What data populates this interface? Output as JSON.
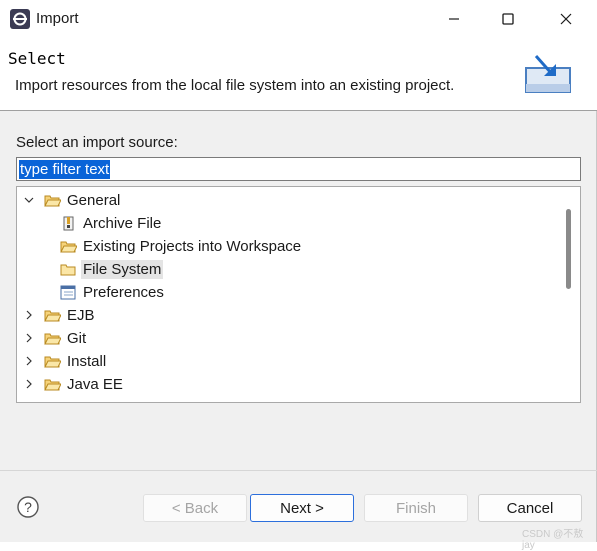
{
  "window": {
    "title": "Import",
    "icon": "eclipse-icon",
    "controls": {
      "minimize": "minimize-icon",
      "maximize": "maximize-icon",
      "close": "close-icon"
    }
  },
  "header": {
    "title": "Select",
    "description": "Import resources from the local file system into an existing project.",
    "graphic": "import-wizard-icon"
  },
  "source": {
    "label": "Select an import source:",
    "filter_value": "type filter text"
  },
  "tree": {
    "items": [
      {
        "label": "General",
        "expanded": true,
        "icon": "folder-open-icon"
      },
      {
        "label": "Archive File",
        "icon": "archive-file-icon"
      },
      {
        "label": "Existing Projects into Workspace",
        "icon": "folder-project-icon"
      },
      {
        "label": "File System",
        "icon": "folder-icon",
        "selected": true
      },
      {
        "label": "Preferences",
        "icon": "preferences-icon"
      },
      {
        "label": "EJB",
        "expanded": false,
        "icon": "folder-icon"
      },
      {
        "label": "Git",
        "expanded": false,
        "icon": "folder-icon"
      },
      {
        "label": "Install",
        "expanded": false,
        "icon": "folder-icon"
      },
      {
        "label": "Java EE",
        "expanded": false,
        "icon": "folder-icon"
      }
    ]
  },
  "buttons": {
    "back": "< Back",
    "next": "Next >",
    "finish": "Finish",
    "cancel": "Cancel",
    "help_icon": "help-icon"
  },
  "watermark": "CSDN @不敖jay",
  "colors": {
    "selection": "#0a64d8",
    "primary_border": "#2c6fdc",
    "folder": "#e8b84a"
  }
}
